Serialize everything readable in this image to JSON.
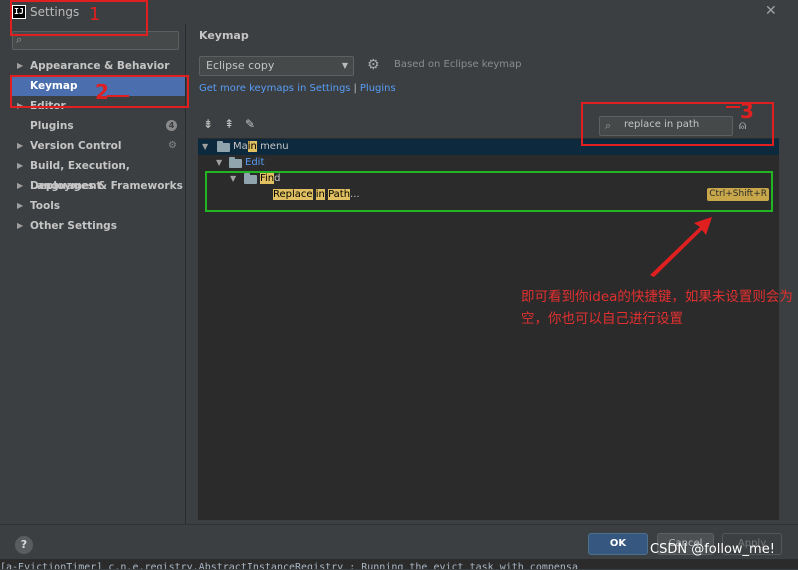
{
  "window": {
    "title": "Settings",
    "app_icon": "IJ",
    "close_icon": "close-icon"
  },
  "sidebar": {
    "search_placeholder": "",
    "items": [
      {
        "label": "Appearance & Behavior",
        "arrow": "▶"
      },
      {
        "label": "Keymap"
      },
      {
        "label": "Editor",
        "arrow": "▶"
      },
      {
        "label": "Plugins",
        "badge": "4"
      },
      {
        "label": "Version Control",
        "arrow": "▶"
      },
      {
        "label": "Build, Execution, Deployment",
        "arrow": "▶"
      },
      {
        "label": "Languages & Frameworks",
        "arrow": "▶"
      },
      {
        "label": "Tools",
        "arrow": "▶"
      },
      {
        "label": "Other Settings",
        "arrow": "▶"
      }
    ]
  },
  "keymap": {
    "heading": "Keymap",
    "scheme": "Eclipse copy",
    "based_on": "Based on Eclipse keymap",
    "link_more": "Get more keymaps in Settings",
    "link_sep": "|",
    "link_plugins": "Plugins",
    "search_value": "replace in path",
    "tree": {
      "main_menu": {
        "pre": "Ma",
        "hl": "in",
        "post": " menu"
      },
      "edit": "Edit",
      "find": {
        "pre": "",
        "hl": "Fin",
        "post": "d"
      },
      "action": {
        "hl1": "Replace",
        "mid": " ",
        "hl2": "in",
        "mid2": " ",
        "hl3": "Path",
        "post": "...",
        "shortcut": "Ctrl+Shift+R"
      }
    }
  },
  "annotations": {
    "mark1": "1",
    "mark2": "2",
    "mark3": "3",
    "note": "即可看到你idea的快捷键，如果未设置则会为空，你也可以自己进行设置"
  },
  "buttons": {
    "help": "?",
    "ok": "OK",
    "cancel": "Cancel",
    "apply": "Apply"
  },
  "console": "[a-EvictionTimer] c.n.e.registry.AbstractInstanceRegistry  : Running the evict task with compensa",
  "watermark": "CSDN @follow_me!",
  "colors": {
    "selection": "#4b6eaf",
    "link": "#589df6",
    "highlight": "#e0c060",
    "annotation": "#e02020",
    "box_green": "#21b521"
  }
}
